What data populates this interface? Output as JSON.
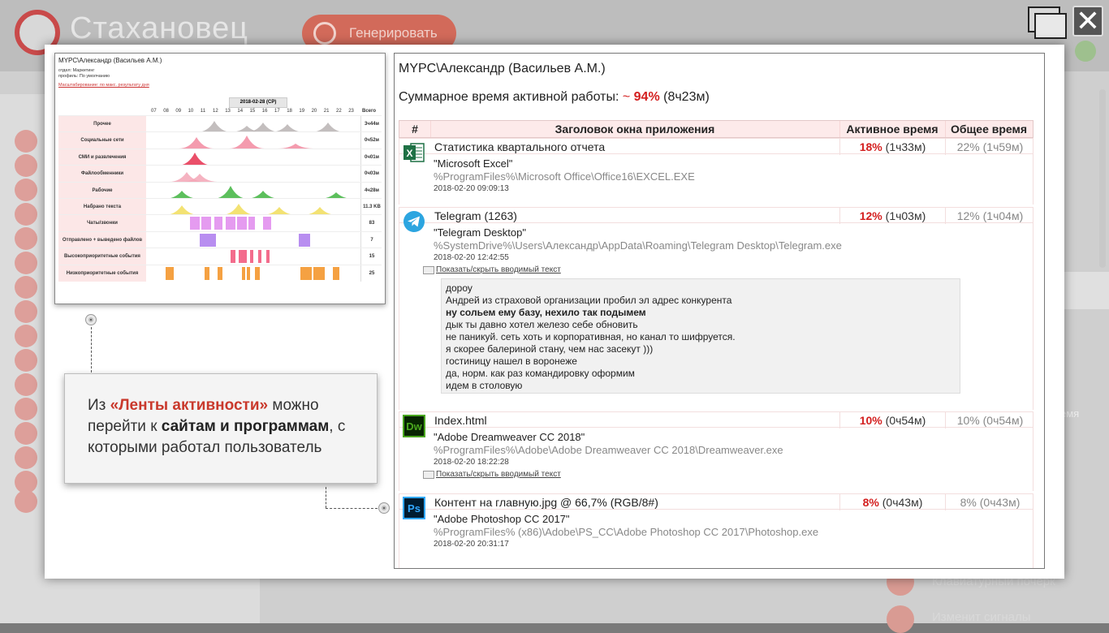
{
  "background": {
    "app_title": "Стахановец",
    "generate_label": "Генерировать",
    "right_text": "емя",
    "bottom_text_1": "Клавиатурный почерк",
    "bottom_text_2": "Изменит сигналы"
  },
  "thumbnail": {
    "user": "MYPC\\Александр (Васильев А.М.)",
    "dept": "отдел: Маркетинг",
    "profile": "профиль: По умолчанию",
    "link": "Масштабирование: по макс. результату дня",
    "date": "2018-02-28 (СР)",
    "hours": [
      "07",
      "08",
      "09",
      "10",
      "11",
      "12",
      "13",
      "14",
      "15",
      "16",
      "17",
      "18",
      "19",
      "20",
      "21",
      "22",
      "23"
    ],
    "total_label": "Всего",
    "rows": [
      {
        "label": "Прочее",
        "value": "3ч44м"
      },
      {
        "label": "Социальные сети",
        "value": "0ч52м"
      },
      {
        "label": "СМИ и развлечения",
        "value": "0ч01м"
      },
      {
        "label": "Файлообменники",
        "value": "0ч03м"
      },
      {
        "label": "Рабочие",
        "value": "4ч28м"
      },
      {
        "label": "Набрано текста",
        "value": "11.3 KB"
      },
      {
        "label": "Чаты/звонки",
        "value": "83"
      },
      {
        "label": "Отправлено + выведено файлов",
        "value": "7"
      },
      {
        "label": "Высокоприоритетные события",
        "value": "15"
      },
      {
        "label": "Низкоприоритетные события",
        "value": "25"
      }
    ]
  },
  "callout": {
    "pre": "Из ",
    "highlight": "«Ленты активности»",
    "mid1": " можно перейти к ",
    "bold": "сайтам и программам",
    "post": ", с которыми работал пользователь"
  },
  "report": {
    "user": "MYPC\\Александр (Васильев А.М.)",
    "summary_label": "Суммарное время активной работы: ",
    "summary_tilde": "~ ",
    "summary_pct": "94%",
    "summary_time": " (8ч23м)",
    "headers": {
      "num": "#",
      "title": "Заголовок окна приложения",
      "active": "Активное время",
      "total": "Общее время"
    },
    "apps": [
      {
        "icon": "excel-icon",
        "title": "Статистика квартального отчета",
        "active_pct": "18%",
        "active_time": " (1ч33м)",
        "total": "22% (1ч59м)",
        "name": "\"Microsoft Excel\"",
        "path": "%ProgramFiles%\\Microsoft Office\\Office16\\EXCEL.EXE",
        "date": "2018-02-20 09:09:13"
      },
      {
        "icon": "telegram-icon",
        "title": "Telegram (1263)",
        "active_pct": "12%",
        "active_time": " (1ч03м)",
        "total": "12% (1ч04м)",
        "name": "\"Telegram Desktop\"",
        "path": "%SystemDrive%\\Users\\Александр\\AppData\\Roaming\\Telegram Desktop\\Telegram.exe",
        "date": "2018-02-20 12:42:55",
        "toggle": "Показать/скрыть вводимый текст",
        "messages": [
          "дороу",
          "Андрей из страховой организации пробил эл адрес конкурента",
          "ну сольем ему базу, нехило так подымем",
          "дык ты давно хотел железо себе обновить",
          "не паникуй. сеть хоть и корпоративная, но канал то шифруется.",
          "я скорее балериной стану, чем нас засекут )))",
          "гостиницу нашел в воронеже",
          "да, норм. как раз командировку оформим",
          "идем в столовую"
        ]
      },
      {
        "icon": "dreamweaver-icon",
        "title": "Index.html",
        "active_pct": "10%",
        "active_time": " (0ч54м)",
        "total": "10% (0ч54м)",
        "name": "\"Adobe Dreamweaver CC 2018\"",
        "path": "%ProgramFiles%\\Adobe\\Adobe Dreamweaver CC 2018\\Dreamweaver.exe",
        "date": "2018-02-20 18:22:28",
        "toggle": "Показать/скрыть вводимый текст"
      },
      {
        "icon": "photoshop-icon",
        "title": "Контент на главную.jpg @ 66,7% (RGB/8#)",
        "active_pct": "8%",
        "active_time": " (0ч43м)",
        "total": "8% (0ч43м)",
        "name": "\"Adobe Photoshop CC 2017\"",
        "path": "%ProgramFiles% (x86)\\Adobe\\PS_CC\\Adobe Photoshop CC 2017\\Photoshop.exe",
        "date": "2018-02-20 20:31:17"
      }
    ]
  }
}
